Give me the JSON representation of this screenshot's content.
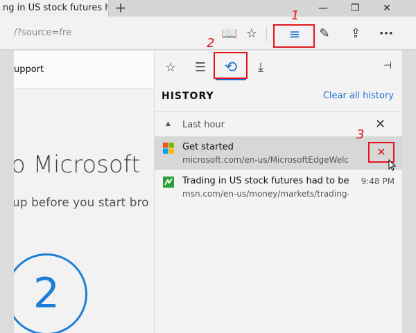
{
  "titlebar": {
    "tab_title": "ng in US stock futures h",
    "new_tab": "+",
    "minimize": "—",
    "restore": "❐",
    "close": "✕"
  },
  "addressbar": {
    "url": "/?source=fre",
    "icons": {
      "reading_view": "📖",
      "favorite": "☆",
      "hub": "≡",
      "web_note": "✎",
      "share": "⇪",
      "more": "···"
    }
  },
  "page": {
    "support": "upport",
    "headline": "o Microsoft",
    "subline": "up before you start bro",
    "step": "2"
  },
  "hub": {
    "tabs": {
      "favorites": "☆",
      "reading_list": "☰",
      "history": "⟲",
      "downloads": "⤓"
    },
    "pin": "⊣",
    "title": "HISTORY",
    "clear_all": "Clear all history",
    "group": {
      "caret": "▲",
      "label": "Last hour",
      "close": "✕"
    },
    "items": [
      {
        "title": "Get started",
        "url": "microsoft.com/en-us/MicrosoftEdgeWelcc",
        "remove": "✕"
      },
      {
        "title": "Trading in US stock futures had to be halte",
        "url": "msn.com/en-us/money/markets/trading-ir",
        "time": "9:48 PM"
      }
    ]
  },
  "annotations": {
    "one": "1",
    "two": "2",
    "three": "3"
  },
  "colors": {
    "accent": "#1d6fd0",
    "annotation": "#e3141c"
  }
}
